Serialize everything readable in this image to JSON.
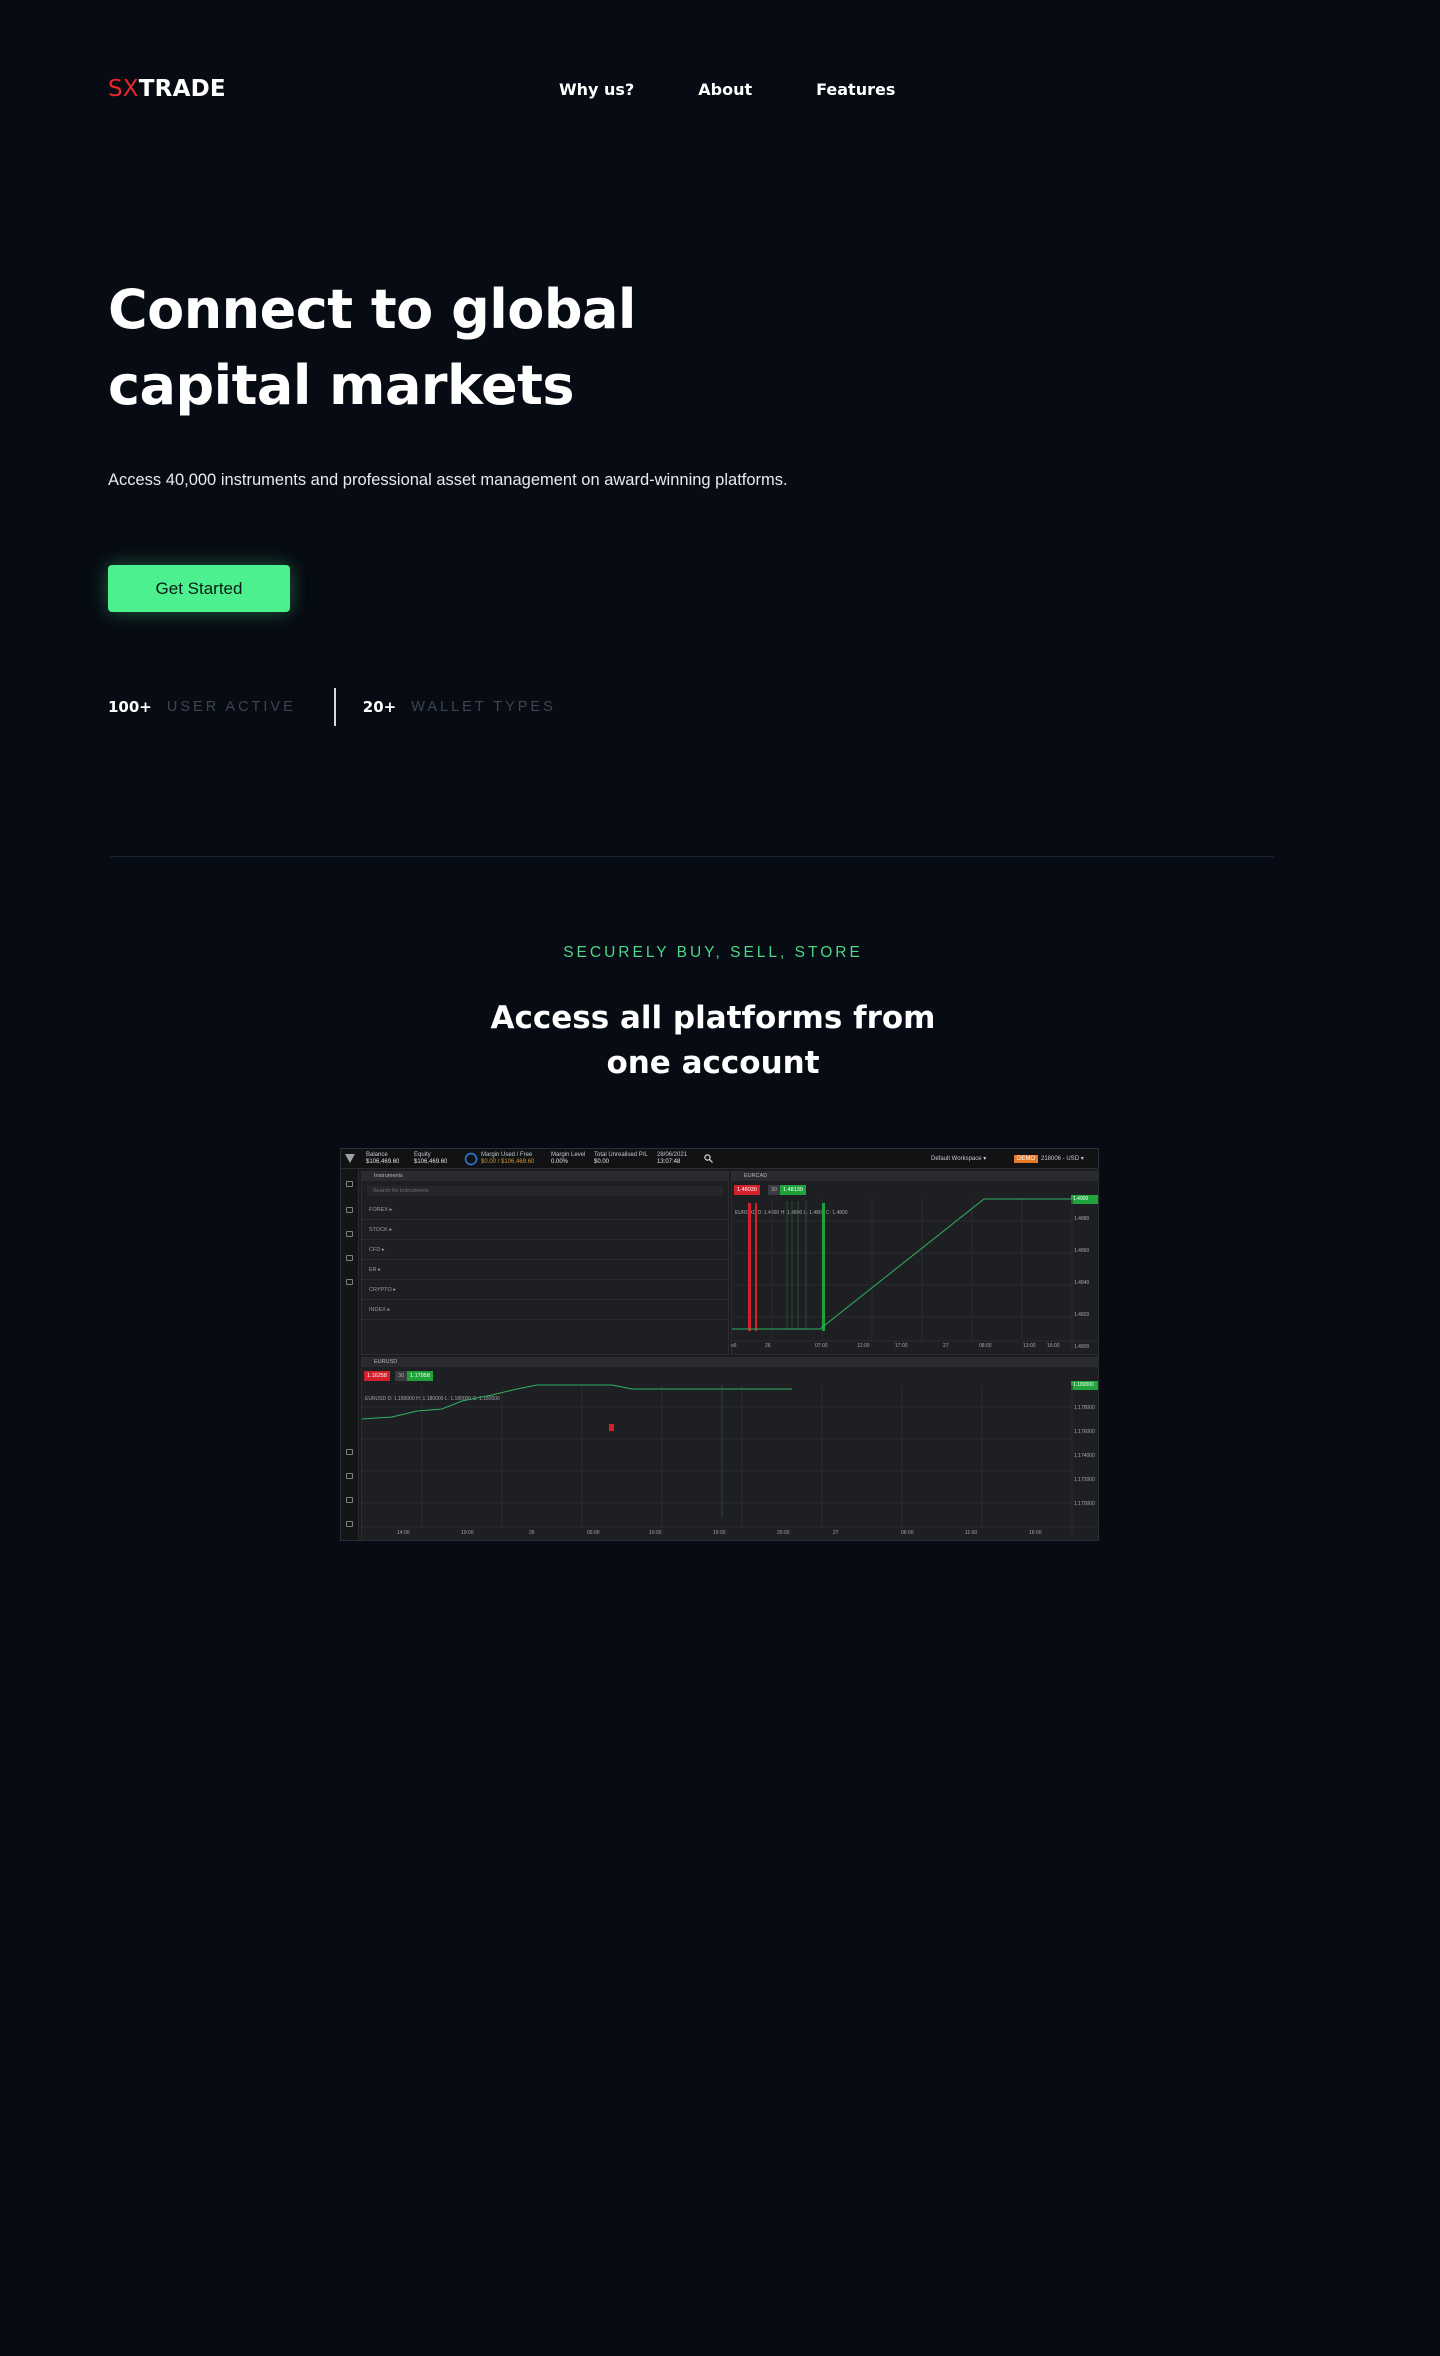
{
  "nav": {
    "logo_prefix": "SX",
    "logo_suffix": "TRADE",
    "links": [
      "Why us?",
      "About",
      "Features"
    ]
  },
  "hero": {
    "title_line1": "Connect to global",
    "title_line2": "capital markets",
    "subtitle": "Access 40,000 instruments and professional asset management on award-winning platforms.",
    "cta_label": "Get Started"
  },
  "stats": [
    {
      "value": "100+",
      "label": "USER ACTIVE"
    },
    {
      "value": "20+",
      "label": "WALLET TYPES"
    }
  ],
  "platforms": {
    "kicker": "SECURELY BUY, SELL, STORE",
    "title": "Access all platforms from one account"
  },
  "screenshot": {
    "topbar": {
      "balance_label": "Balance",
      "balance_value": "$106,469.60",
      "equity_label": "Equity",
      "equity_value": "$106,469.60",
      "margin_label": "Margin Used / Free",
      "margin_value": "$0.00 / $106,469.60",
      "margin_level_label": "Margin Level",
      "margin_level_value": "0.00%",
      "pnl_label": "Total Unrealised P/L",
      "pnl_value": "$0.00",
      "date": "28/06/2021",
      "time": "13:07:48",
      "workspace": "Default Workspace ▾",
      "demo_badge": "DEMO",
      "account": "218006 - USD ▾"
    },
    "instruments": {
      "title": "Instruments",
      "search_placeholder": "Search for Instruments",
      "rows": [
        "FOREX ▸",
        "STOCK ▸",
        "CFD ▸",
        "ER ▸",
        "CRYPTO ▸",
        "INDEX ▸"
      ]
    },
    "chart_top": {
      "title": "EURCAD",
      "sell": "1.48030",
      "spread": "30",
      "buy": "1.48130",
      "ohlc": "EURCAD D: 1.4800 H: 1.4800 L: 1.4800 C: 1.4800",
      "price_tag": "1.4900",
      "y_ticks": [
        "1.4880",
        "1.4860",
        "1.4840",
        "1.4820",
        "1.4800"
      ],
      "x_ticks": [
        "o6",
        "26",
        "07:00",
        "12:00",
        "17:00",
        "27",
        "08:00",
        "13:00",
        "16:00"
      ]
    },
    "chart_bottom": {
      "title": "EURUSD",
      "sell": "1.16258",
      "spread": "30",
      "buy": "1.17958",
      "ohlc": "EURUSD D: 1.180000 H: 1.180000 L: 1.180000 C: 1.180000",
      "price_tag": "1.180000",
      "y_ticks": [
        "1.178000",
        "1.176000",
        "1.174000",
        "1.172000",
        "1.170000"
      ],
      "x_ticks": [
        "14:00",
        "19:00",
        "26",
        "05:00",
        "10:00",
        "15:00",
        "20:00",
        "27",
        "06:00",
        "11:00",
        "16:00"
      ]
    }
  }
}
